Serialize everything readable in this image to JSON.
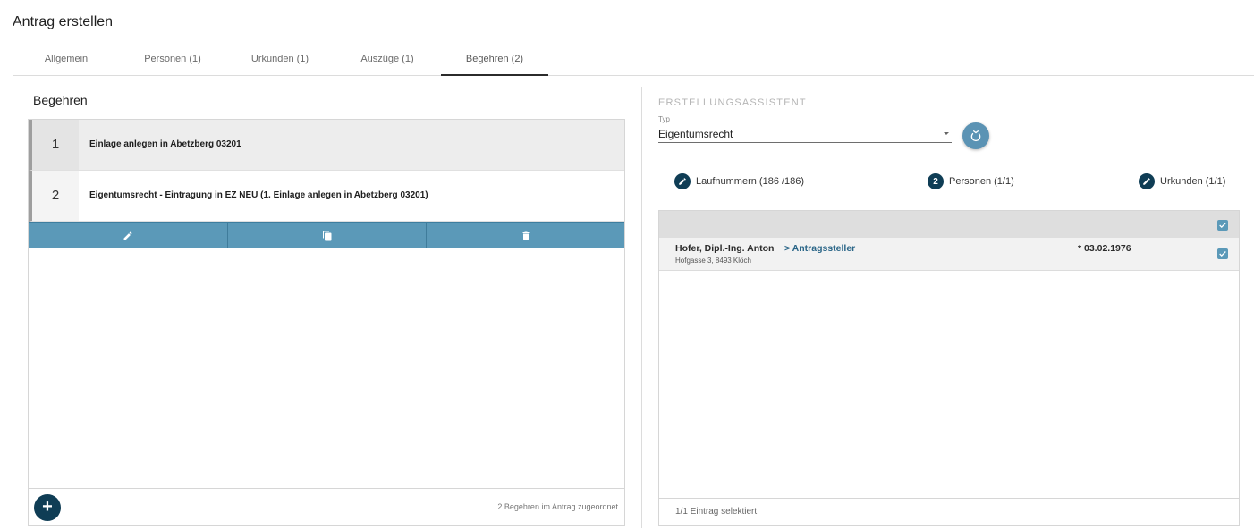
{
  "page": {
    "title": "Antrag erstellen"
  },
  "tabs": [
    {
      "label": "Allgemein"
    },
    {
      "label": "Personen (1)"
    },
    {
      "label": "Urkunden (1)"
    },
    {
      "label": "Auszüge (1)"
    },
    {
      "label": "Begehren (2)",
      "active": true
    }
  ],
  "begehren": {
    "title": "Begehren",
    "items": [
      {
        "number": "1",
        "text": "Einlage anlegen in Abetzberg 03201",
        "selected": true
      },
      {
        "number": "2",
        "text": "Eigentumsrecht - Eintragung in EZ NEU (1. Einlage anlegen in Abetzberg 03201)"
      }
    ],
    "actions": [
      {
        "icon": "pencil-icon"
      },
      {
        "icon": "copy-icon"
      },
      {
        "icon": "trash-icon"
      }
    ],
    "add_icon": "plus-icon",
    "add_label": "+",
    "footer_text": "2 Begehren im Antrag zugeordnet"
  },
  "assistant": {
    "title": "ERSTELLUNGSASSISTENT",
    "typ_label": "Typ",
    "typ_value": "Eigentumsrecht",
    "reset_icon": "reset-icon",
    "steps": [
      {
        "label": "Laufnummern (186 /186)",
        "icon": "pencil-icon",
        "marker": ""
      },
      {
        "label": "Personen (1/1)",
        "icon": "",
        "marker": "2"
      },
      {
        "label": "Urkunden (1/1)",
        "icon": "pencil-icon",
        "marker": ""
      }
    ],
    "persons": [
      {
        "name": "Hofer, Dipl.-Ing. Anton",
        "address": "Hofgasse 3, 8493 Klöch",
        "role": "> Antragssteller",
        "birth": "* 03.02.1976",
        "checked": true
      }
    ],
    "select_all_checked": true,
    "footer_text": "1/1 Eintrag selektiert"
  },
  "colors": {
    "primary_dark": "#0f3d55",
    "action_bar": "#5b99b8",
    "role_link": "#2b6688"
  }
}
